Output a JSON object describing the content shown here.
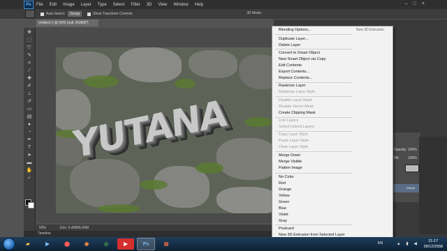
{
  "app": {
    "name": "Ps",
    "menu": [
      "File",
      "Edit",
      "Image",
      "Layer",
      "Type",
      "Select",
      "Filter",
      "3D",
      "View",
      "Window",
      "Help"
    ],
    "window_controls": [
      "–",
      "□",
      "×"
    ]
  },
  "options_bar": {
    "auto_select_label": "Auto-Select:",
    "auto_select_value": "Group",
    "show_transform_label": "Show Transform Controls",
    "mode_label": "3D Mode:"
  },
  "document": {
    "tab_title": "Untitled-1 @ 50% (null, RGB/8*)",
    "zoom": "50%",
    "doc_size": "Doc: 5.40M/5.43M",
    "timeline_label": "Timeline",
    "artwork_text": "YUTANA"
  },
  "panel": {
    "side_label": "New 3D Extrusion",
    "opacity_label": "Opacity:",
    "opacity_value": "100%",
    "fill_label": "Fill:",
    "fill_value": "100%",
    "layer_name": "Diffuse"
  },
  "context_menu": {
    "items": [
      {
        "label": "Blending Options...",
        "enabled": true
      },
      {
        "label": "Duplicate Layer...",
        "enabled": true
      },
      {
        "label": "Delete Layer",
        "enabled": true
      },
      {
        "label": "Convert to Smart Object",
        "enabled": true
      },
      {
        "label": "New Smart Object via Copy",
        "enabled": true
      },
      {
        "label": "Edit Contents",
        "enabled": true
      },
      {
        "label": "Export Contents...",
        "enabled": true
      },
      {
        "label": "Replace Contents...",
        "enabled": true
      },
      {
        "label": "Rasterize Layer",
        "enabled": true
      },
      {
        "label": "Rasterize Layer Style",
        "enabled": false
      },
      {
        "label": "Disable Layer Mask",
        "enabled": false
      },
      {
        "label": "Disable Vector Mask",
        "enabled": false
      },
      {
        "label": "Create Clipping Mask",
        "enabled": true
      },
      {
        "label": "Link Layers",
        "enabled": false
      },
      {
        "label": "Select Linked Layers",
        "enabled": false
      },
      {
        "label": "Copy Layer Style",
        "enabled": false
      },
      {
        "label": "Paste Layer Style",
        "enabled": false
      },
      {
        "label": "Clear Layer Style",
        "enabled": false
      },
      {
        "label": "Merge Down",
        "enabled": true
      },
      {
        "label": "Merge Visible",
        "enabled": true
      },
      {
        "label": "Flatten Image",
        "enabled": true
      },
      {
        "label": "No Color",
        "enabled": true
      },
      {
        "label": "Red",
        "enabled": true
      },
      {
        "label": "Orange",
        "enabled": true
      },
      {
        "label": "Yellow",
        "enabled": true
      },
      {
        "label": "Green",
        "enabled": true
      },
      {
        "label": "Blue",
        "enabled": true
      },
      {
        "label": "Violet",
        "enabled": true
      },
      {
        "label": "Gray",
        "enabled": true
      },
      {
        "label": "Postcard",
        "enabled": true
      },
      {
        "label": "New 3D Extrusion from Selected Layer",
        "enabled": true
      }
    ]
  },
  "taskbar": {
    "apps": [
      "chrome-icon",
      "folder-icon",
      "media-icon",
      "antivirus-icon",
      "browser-icon",
      "youtube-icon",
      "photoshop-icon",
      "document-icon"
    ],
    "language": "EN",
    "time": "21:17",
    "date": "28/12/2558"
  },
  "colors": {
    "accent": "#0a2f55",
    "menu_bg": "#f2f2f2",
    "taskbar": "#1f3d5a"
  }
}
